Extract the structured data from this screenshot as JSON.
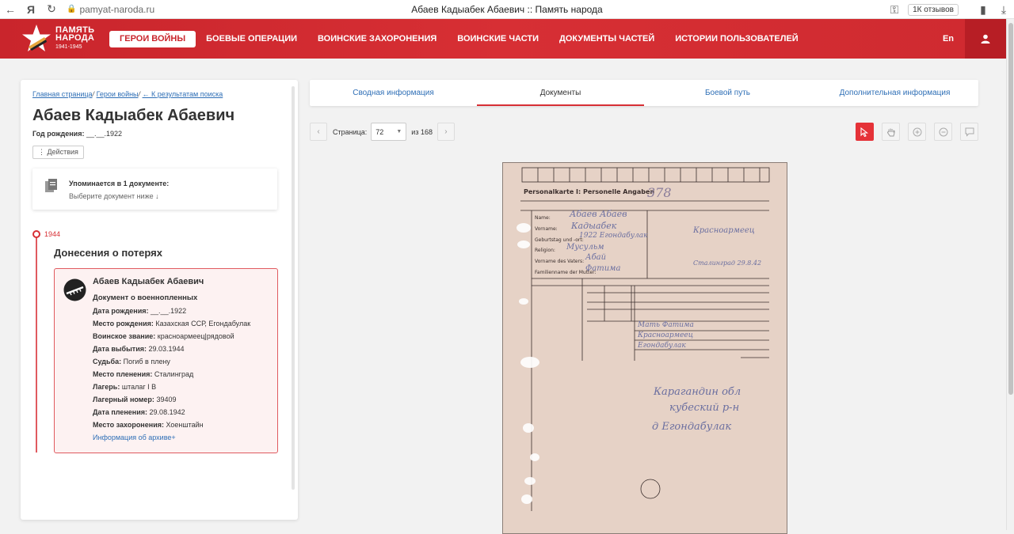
{
  "browser": {
    "url": "pamyat-naroda.ru",
    "title": "Абаев Кадыабек Абаевич :: Память народа",
    "reviews": "1К отзывов"
  },
  "header": {
    "logo_line1": "ПАМЯТЬ",
    "logo_line2": "НАРОДА",
    "logo_years": "1941-1945",
    "nav": [
      {
        "label": "ГЕРОИ ВОЙНЫ"
      },
      {
        "label": "БОЕВЫЕ ОПЕРАЦИИ"
      },
      {
        "label": "ВОИНСКИЕ ЗАХОРОНЕНИЯ"
      },
      {
        "label": "ВОИНСКИЕ ЧАСТИ"
      },
      {
        "label": "ДОКУМЕНТЫ ЧАСТЕЙ"
      },
      {
        "label": "ИСТОРИИ ПОЛЬЗОВАТЕЛЕЙ"
      }
    ],
    "lang": "En"
  },
  "left": {
    "breadcrumb": [
      "Главная страница",
      "Герои войны",
      "← К результатам поиска"
    ],
    "name": "Абаев Кадыабек Абаевич",
    "birth_label": "Год рождения:",
    "birth_value": "__.__.1922",
    "actions": "⋮ Действия",
    "mention_title": "Упоминается в 1 документе:",
    "mention_sub": "Выберите документ ниже ↓",
    "year": "1944",
    "section_title": "Донесения о потерях",
    "card": {
      "name": "Абаев Кадыабек Абаевич",
      "type": "Документ о военнопленных",
      "fields": [
        {
          "label": "Дата рождения:",
          "value": "__.__.1922"
        },
        {
          "label": "Место рождения:",
          "value": "Казахская ССР, Егондабулак"
        },
        {
          "label": "Воинское звание:",
          "value": "красноармеец|рядовой"
        },
        {
          "label": "Дата выбытия:",
          "value": "29.03.1944"
        },
        {
          "label": "Судьба:",
          "value": "Погиб в плену"
        },
        {
          "label": "Место пленения:",
          "value": "Сталинград"
        },
        {
          "label": "Лагерь:",
          "value": "шталаг I B"
        },
        {
          "label": "Лагерный номер:",
          "value": "39409"
        },
        {
          "label": "Дата пленения:",
          "value": "29.08.1942"
        },
        {
          "label": "Место захоронения:",
          "value": "Хоенштайн"
        }
      ],
      "archive_link": "Информация об архиве+"
    }
  },
  "tabs": [
    {
      "label": "Сводная информация"
    },
    {
      "label": "Документы"
    },
    {
      "label": "Боевой путь"
    },
    {
      "label": "Дополнительная информация"
    }
  ],
  "pager": {
    "label": "Страница:",
    "current": "72",
    "of": "из 168"
  },
  "document": {
    "header_print": "Personalkarte I: Personelle Angaben",
    "number": "378",
    "field_labels": [
      "Name:",
      "Vorname:",
      "Geburtstag und -ort:",
      "Religion:",
      "Vorname des Vaters:",
      "Familienname der Mutter:"
    ],
    "handwriting": [
      "Абаев Абаев",
      "Кадыабек",
      "1922 Егондабулак",
      "Мусульм",
      "Абай",
      "Фатима",
      "Красноармеец",
      "Сталинград 29.8.42",
      "Мать Фатима",
      "Красноармеец",
      "Егондабулак",
      "Карагандин обл",
      "кубеский р-н",
      "д Егондабулак"
    ]
  }
}
